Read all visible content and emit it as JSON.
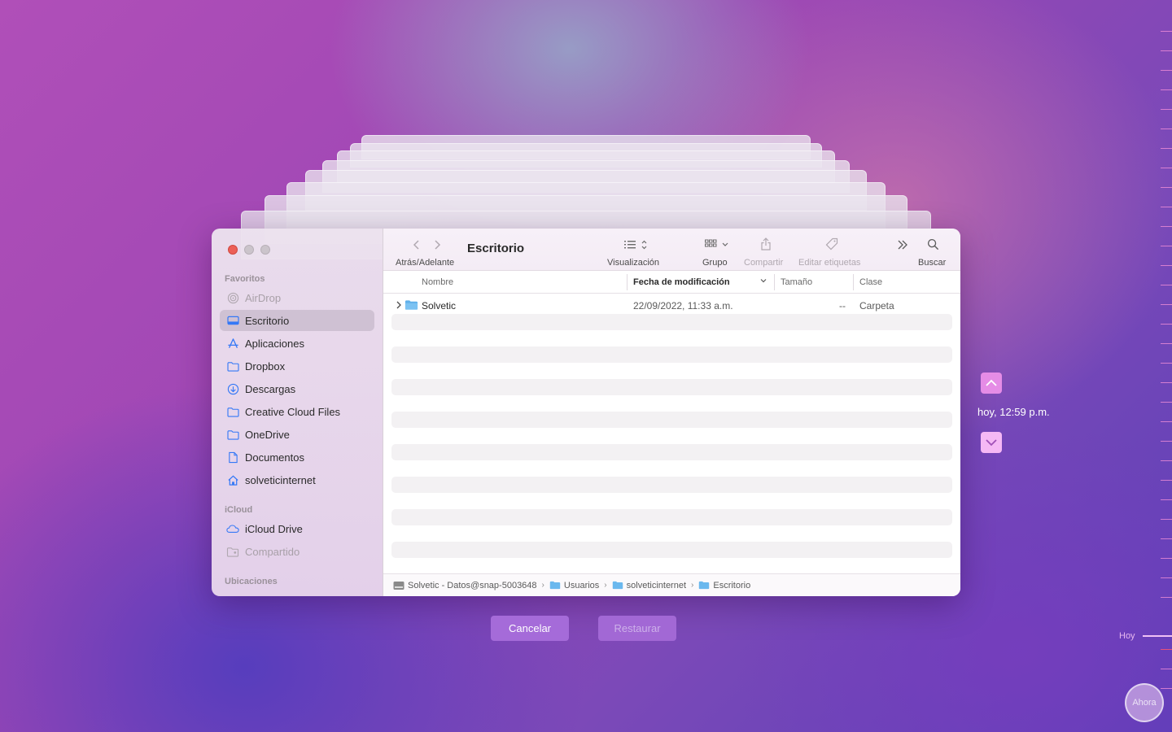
{
  "window": {
    "title": "Escritorio"
  },
  "toolbar": {
    "back_forward_label": "Atrás/Adelante",
    "view_label": "Visualización",
    "group_label": "Grupo",
    "share_label": "Compartir",
    "tags_label": "Editar etiquetas",
    "search_label": "Buscar"
  },
  "sidebar": {
    "favorites_title": "Favoritos",
    "icloud_title": "iCloud",
    "locations_title": "Ubicaciones",
    "favorites": [
      {
        "label": "AirDrop",
        "icon": "airdrop-icon",
        "disabled": true
      },
      {
        "label": "Escritorio",
        "icon": "desktop-icon",
        "selected": true
      },
      {
        "label": "Aplicaciones",
        "icon": "applications-icon"
      },
      {
        "label": "Dropbox",
        "icon": "folder-icon"
      },
      {
        "label": "Descargas",
        "icon": "download-icon"
      },
      {
        "label": "Creative Cloud Files",
        "icon": "folder-icon"
      },
      {
        "label": "OneDrive",
        "icon": "folder-icon"
      },
      {
        "label": "Documentos",
        "icon": "document-icon"
      },
      {
        "label": "solveticinternet",
        "icon": "home-icon"
      }
    ],
    "icloud": [
      {
        "label": "iCloud Drive",
        "icon": "cloud-icon"
      },
      {
        "label": "Compartido",
        "icon": "shared-folder-icon",
        "disabled": true
      }
    ]
  },
  "columns": {
    "name": "Nombre",
    "date": "Fecha de modificación",
    "size": "Tamaño",
    "kind": "Clase"
  },
  "files": [
    {
      "name": "Solvetic",
      "date": "22/09/2022, 11:33 a.m.",
      "size": "--",
      "kind": "Carpeta"
    }
  ],
  "pathbar": {
    "items": [
      "Solvetic - Datos@snap-5003648",
      "Usuarios",
      "solveticinternet",
      "Escritorio"
    ]
  },
  "buttons": {
    "cancel": "Cancelar",
    "restore": "Restaurar"
  },
  "timemachine": {
    "time_label": "hoy, 12:59 p.m.",
    "today_label": "Hoy",
    "now_label": "Ahora"
  },
  "colors": {
    "accent": "#a56bd9",
    "close": "#ec5f57",
    "selected_sidebar": "#3478f6"
  }
}
